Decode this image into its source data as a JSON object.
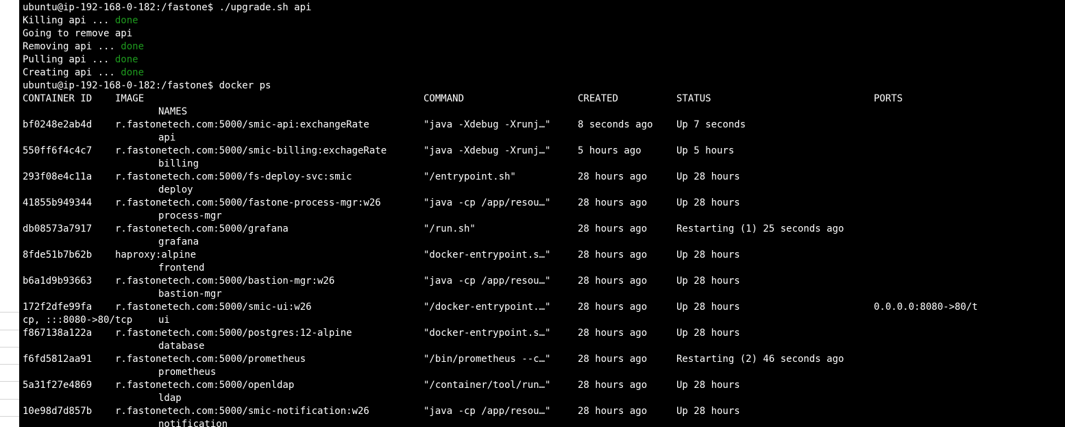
{
  "terminal": {
    "prompt": "ubuntu@ip-192-168-0-182:/fastone$",
    "command_1": "./upgrade.sh api",
    "output": [
      {
        "text": "Killing api ... ",
        "status": "done"
      },
      {
        "text": "Going to remove api",
        "status": ""
      },
      {
        "text": "Removing api ... ",
        "status": "done"
      },
      {
        "text": "Pulling api ... ",
        "status": "done"
      },
      {
        "text": "Creating api ... ",
        "status": "done"
      }
    ],
    "command_2": "docker ps",
    "headers": {
      "container_id": "CONTAINER ID",
      "image": "IMAGE",
      "command": "COMMAND",
      "created": "CREATED",
      "status": "STATUS",
      "ports": "PORTS",
      "names": "NAMES"
    },
    "containers": [
      {
        "id": "bf0248e2ab4d",
        "image": "r.fastonetech.com:5000/smic-api:exchangeRate",
        "command": "\"java -Xdebug -Xrunj…\"",
        "created": "8 seconds ago",
        "status": "Up 7 seconds",
        "ports": "",
        "ports_cont": "",
        "name": "api"
      },
      {
        "id": "550ff6f4c4c7",
        "image": "r.fastonetech.com:5000/smic-billing:exchageRate",
        "command": "\"java -Xdebug -Xrunj…\"",
        "created": "5 hours ago",
        "status": "Up 5 hours",
        "ports": "",
        "ports_cont": "",
        "name": "billing"
      },
      {
        "id": "293f08e4c11a",
        "image": "r.fastonetech.com:5000/fs-deploy-svc:smic",
        "command": "\"/entrypoint.sh\"",
        "created": "28 hours ago",
        "status": "Up 28 hours",
        "ports": "",
        "ports_cont": "",
        "name": "deploy"
      },
      {
        "id": "41855b949344",
        "image": "r.fastonetech.com:5000/fastone-process-mgr:w26",
        "command": "\"java -cp /app/resou…\"",
        "created": "28 hours ago",
        "status": "Up 28 hours",
        "ports": "",
        "ports_cont": "",
        "name": "process-mgr"
      },
      {
        "id": "db08573a7917",
        "image": "r.fastonetech.com:5000/grafana",
        "command": "\"/run.sh\"",
        "created": "28 hours ago",
        "status": "Restarting (1) 25 seconds ago",
        "ports": "",
        "ports_cont": "",
        "name": "grafana"
      },
      {
        "id": "8fde51b7b62b",
        "image": "haproxy:alpine",
        "command": "\"docker-entrypoint.s…\"",
        "created": "28 hours ago",
        "status": "Up 28 hours",
        "ports": "",
        "ports_cont": "",
        "name": "frontend"
      },
      {
        "id": "b6a1d9b93663",
        "image": "r.fastonetech.com:5000/bastion-mgr:w26",
        "command": "\"java -cp /app/resou…\"",
        "created": "28 hours ago",
        "status": "Up 28 hours",
        "ports": "",
        "ports_cont": "",
        "name": "bastion-mgr"
      },
      {
        "id": "172f2dfe99fa",
        "image": "r.fastonetech.com:5000/smic-ui:w26",
        "command": "\"/docker-entrypoint.…\"",
        "created": "28 hours ago",
        "status": "Up 28 hours",
        "ports": "0.0.0.0:8080->80/t",
        "ports_cont": "cp, :::8080->80/tcp",
        "name": "ui"
      },
      {
        "id": "f867138a122a",
        "image": "r.fastonetech.com:5000/postgres:12-alpine",
        "command": "\"docker-entrypoint.s…\"",
        "created": "28 hours ago",
        "status": "Up 28 hours",
        "ports": "",
        "ports_cont": "",
        "name": "database"
      },
      {
        "id": "f6fd5812aa91",
        "image": "r.fastonetech.com:5000/prometheus",
        "command": "\"/bin/prometheus --c…\"",
        "created": "28 hours ago",
        "status": "Restarting (2) 46 seconds ago",
        "ports": "",
        "ports_cont": "",
        "name": "prometheus"
      },
      {
        "id": "5a31f27e4869",
        "image": "r.fastonetech.com:5000/openldap",
        "command": "\"/container/tool/run…\"",
        "created": "28 hours ago",
        "status": "Up 28 hours",
        "ports": "",
        "ports_cont": "",
        "name": "ldap"
      },
      {
        "id": "10e98d7d857b",
        "image": "r.fastonetech.com:5000/smic-notification:w26",
        "command": "\"java -cp /app/resou…\"",
        "created": "28 hours ago",
        "status": "Up 28 hours",
        "ports": "",
        "ports_cont": "",
        "name": "notification"
      }
    ]
  },
  "colors": {
    "background": "#000000",
    "foreground": "#ffffff",
    "done": "#1e9a1e"
  }
}
